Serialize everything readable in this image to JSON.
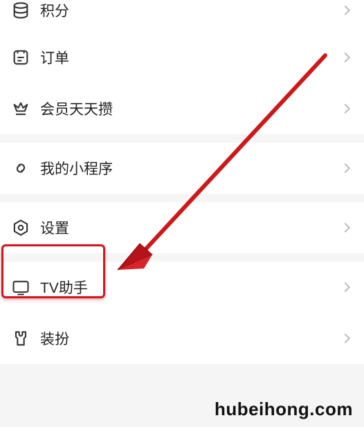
{
  "items": {
    "points": {
      "label": "积分"
    },
    "orders": {
      "label": "订单"
    },
    "member_daily": {
      "label": "会员天天攒"
    },
    "mini_programs": {
      "label": "我的小程序"
    },
    "settings": {
      "label": "设置"
    },
    "tv_helper": {
      "label": "TV助手"
    },
    "decoration": {
      "label": "装扮"
    }
  },
  "watermark": "hubeihong.com",
  "highlight": {
    "target": "settings",
    "color": "#d4141e"
  }
}
